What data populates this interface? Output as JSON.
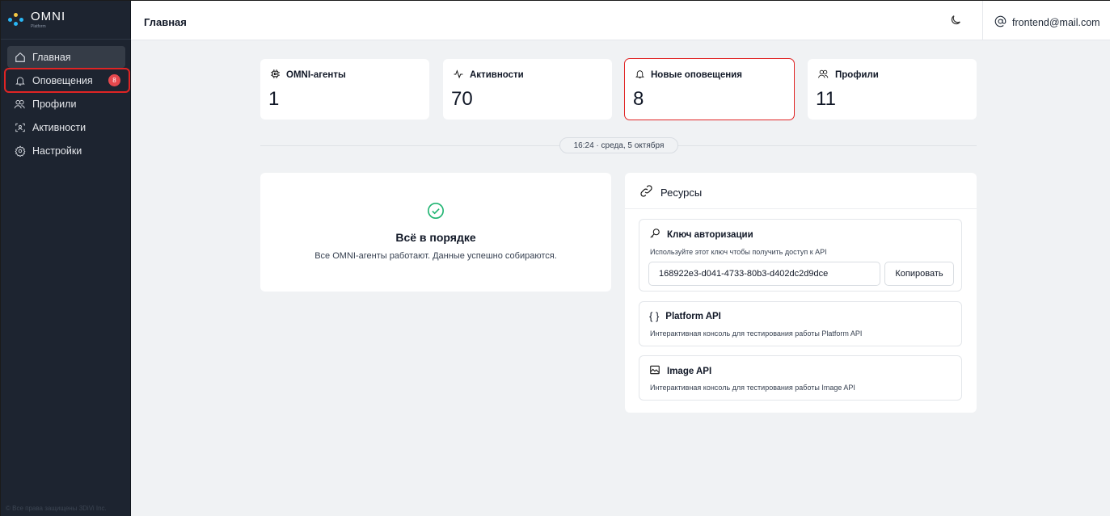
{
  "brand": {
    "logo_text": "OMNI",
    "logo_subtext": "Platform",
    "dot_colors": [
      "#2ab7f5",
      "#f5c842",
      "#2ab7f5",
      "#2ab7f5"
    ]
  },
  "sidebar": {
    "items": [
      {
        "label": "Главная",
        "icon": "home-icon"
      },
      {
        "label": "Оповещения",
        "icon": "bell-icon",
        "badge": "8"
      },
      {
        "label": "Профили",
        "icon": "users-icon"
      },
      {
        "label": "Активности",
        "icon": "scan-face-icon"
      },
      {
        "label": "Настройки",
        "icon": "gear-icon"
      }
    ],
    "copyright": "© Все права защищены 3DiVi Inc."
  },
  "header": {
    "title": "Главная",
    "user_email": "frontend@mail.com"
  },
  "stats": [
    {
      "label": "OMNI-агенты",
      "value": "1",
      "icon": "cpu-icon"
    },
    {
      "label": "Активности",
      "value": "70",
      "icon": "activity-icon"
    },
    {
      "label": "Новые оповещения",
      "value": "8",
      "icon": "bell-icon"
    },
    {
      "label": "Профили",
      "value": "11",
      "icon": "users-icon"
    }
  ],
  "datetime": "16:24 · среда, 5 октября",
  "status": {
    "title": "Всё в порядке",
    "description": "Все OMNI-агенты работают. Данные успешно собираются."
  },
  "resources": {
    "title": "Ресурсы",
    "auth_key": {
      "title": "Ключ авторизации",
      "description": "Используйте этот ключ чтобы получить доступ к API",
      "value": "168922e3-d041-4733-80b3-d402dc2d9dce",
      "copy_label": "Копировать"
    },
    "platform_api": {
      "title": "Platform API",
      "description": "Интерактивная консоль для тестирования работы Platform API"
    },
    "image_api": {
      "title": "Image API",
      "description": "Интерактивная консоль для тестирования работы Image API"
    }
  },
  "colors": {
    "sidebar_bg": "#1d2430",
    "main_bg": "#f0f2f4",
    "badge": "#e5484d",
    "highlight": "#e02424",
    "success": "#22b573"
  }
}
